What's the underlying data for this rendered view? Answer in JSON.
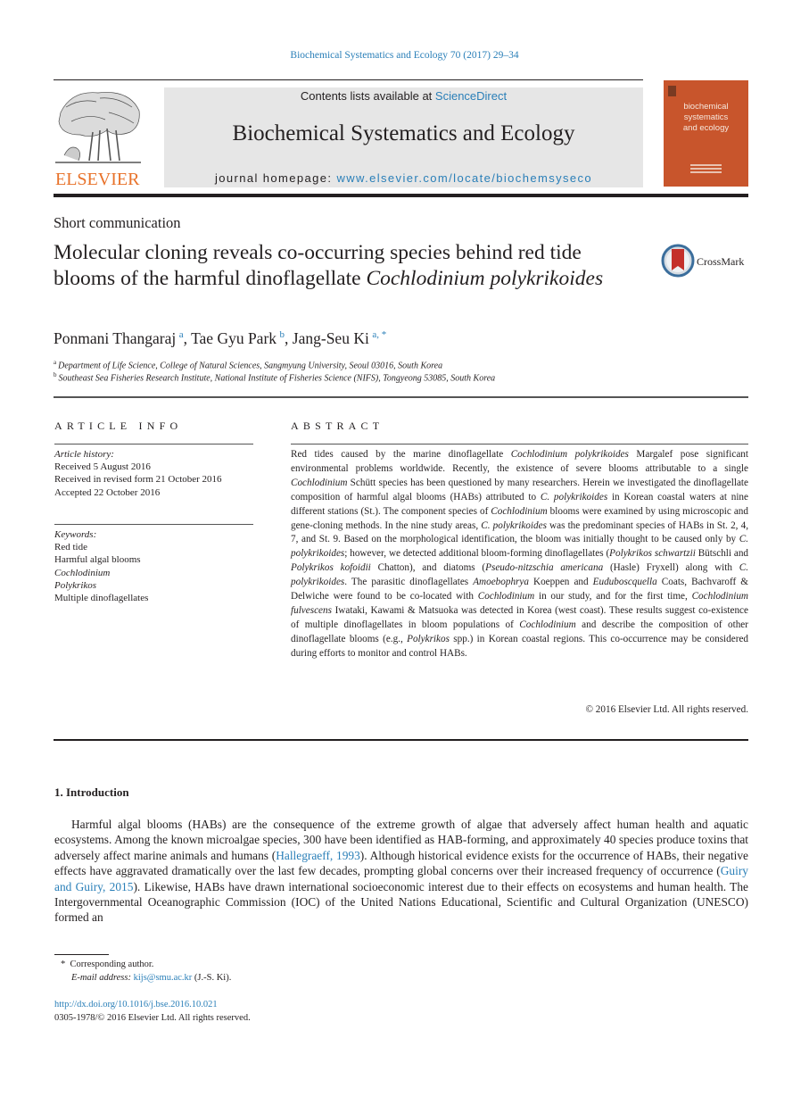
{
  "citation": "Biochemical Systematics and Ecology 70 (2017) 29–34",
  "masthead": {
    "publisher_logo_text": "ELSEVIER",
    "contents_prefix": "Contents lists available at ",
    "contents_link": "ScienceDirect",
    "journal_name": "Biochemical Systematics and Ecology",
    "homepage_prefix": "journal homepage: ",
    "homepage_link": "www.elsevier.com/locate/biochemsyseco",
    "cover_title_lines": [
      "biochemical",
      "systematics",
      "and ecology"
    ]
  },
  "article": {
    "type": "Short communication",
    "title_part1": "Molecular cloning reveals co-occurring species behind red tide blooms of the harmful dinoflagellate ",
    "title_italic": "Cochlodinium polykrikoides",
    "crossmark_label": "CrossMark",
    "authors": [
      {
        "name": "Ponmani Thangaraj",
        "sup": "a",
        "sep": ", "
      },
      {
        "name": "Tae Gyu Park",
        "sup": "b",
        "sep": ", "
      },
      {
        "name": "Jang-Seu Ki",
        "sup": "a, *",
        "sep": ""
      }
    ],
    "affiliations": [
      {
        "mark": "a",
        "text": "Department of Life Science, College of Natural Sciences, Sangmyung University, Seoul 03016, South Korea"
      },
      {
        "mark": "b",
        "text": "Southeast Sea Fisheries Research Institute, National Institute of Fisheries Science (NIFS), Tongyeong 53085, South Korea"
      }
    ]
  },
  "article_info": {
    "heading": "ARTICLE INFO",
    "history_label": "Article history:",
    "history": [
      "Received 5 August 2016",
      "Received in revised form 21 October 2016",
      "Accepted 22 October 2016"
    ],
    "keywords_label": "Keywords:",
    "keywords": [
      {
        "text": "Red tide",
        "italic": false
      },
      {
        "text": "Harmful algal blooms",
        "italic": false
      },
      {
        "text": "Cochlodinium",
        "italic": true
      },
      {
        "text": "Polykrikos",
        "italic": true
      },
      {
        "text": "Multiple dinoflagellates",
        "italic": false
      }
    ]
  },
  "abstract": {
    "heading": "ABSTRACT",
    "segments": [
      {
        "t": "Red tides caused by the marine dinoflagellate "
      },
      {
        "t": "Cochlodinium polykrikoides",
        "i": true
      },
      {
        "t": " Margalef pose significant environmental problems worldwide. Recently, the existence of severe blooms attributable to a single "
      },
      {
        "t": "Cochlodinium",
        "i": true
      },
      {
        "t": " Schütt species has been questioned by many researchers. Herein we investigated the dinoflagellate composition of harmful algal blooms (HABs) attributed to "
      },
      {
        "t": "C. polykrikoides",
        "i": true
      },
      {
        "t": " in Korean coastal waters at nine different stations (St.). The component species of "
      },
      {
        "t": "Cochlodinium",
        "i": true
      },
      {
        "t": " blooms were examined by using microscopic and gene-cloning methods. In the nine study areas, "
      },
      {
        "t": "C. polykrikoides",
        "i": true
      },
      {
        "t": " was the predominant species of HABs in St. 2, 4, 7, and St. 9. Based on the morphological identification, the bloom was initially thought to be caused only by "
      },
      {
        "t": "C. polykrikoides",
        "i": true
      },
      {
        "t": "; however, we detected additional bloom-forming dinoflagellates ("
      },
      {
        "t": "Polykrikos schwartzii",
        "i": true
      },
      {
        "t": " Bütschli and "
      },
      {
        "t": "Polykrikos kofoidii",
        "i": true
      },
      {
        "t": " Chatton), and diatoms ("
      },
      {
        "t": "Pseudo-nitzschia americana",
        "i": true
      },
      {
        "t": " (Hasle) Fryxell) along with "
      },
      {
        "t": "C. polykrikoides",
        "i": true
      },
      {
        "t": ". The parasitic dinoflagellates "
      },
      {
        "t": "Amoebophrya",
        "i": true
      },
      {
        "t": " Koeppen and "
      },
      {
        "t": "Euduboscquella",
        "i": true
      },
      {
        "t": " Coats, Bachvaroff & Delwiche were found to be co-located with "
      },
      {
        "t": "Cochlodinium",
        "i": true
      },
      {
        "t": " in our study, and for the first time, "
      },
      {
        "t": "Cochlodinium fulvescens",
        "i": true
      },
      {
        "t": " Iwataki, Kawami & Matsuoka was detected in Korea (west coast). These results suggest co-existence of multiple dinoflagellates in bloom populations of "
      },
      {
        "t": "Cochlodinium",
        "i": true
      },
      {
        "t": " and describe the composition of other dinoflagellate blooms (e.g., "
      },
      {
        "t": "Polykrikos",
        "i": true
      },
      {
        "t": " spp.) in Korean coastal regions. This co-occurrence may be considered during efforts to monitor and control HABs."
      }
    ],
    "copyright": "© 2016 Elsevier Ltd. All rights reserved."
  },
  "introduction": {
    "heading": "1.  Introduction",
    "segments": [
      {
        "t": "Harmful algal blooms (HABs) are the consequence of the extreme growth of algae that adversely affect human health and aquatic ecosystems. Among the known microalgae species, 300 have been identified as HAB-forming, and approximately 40 species produce toxins that adversely affect marine animals and humans ("
      },
      {
        "t": "Hallegraeff, 1993",
        "link": true
      },
      {
        "t": "). Although historical evidence exists for the occurrence of HABs, their negative effects have aggravated dramatically over the last few decades, prompting global concerns over their increased frequency of occurrence ("
      },
      {
        "t": "Guiry and Guiry, 2015",
        "link": true
      },
      {
        "t": "). Likewise, HABs have drawn international socioeconomic interest due to their effects on ecosystems and human health. The Intergovernmental Oceanographic Commission (IOC) of the United Nations Educational, Scientific and Cultural Organization (UNESCO) formed an"
      }
    ]
  },
  "footnotes": {
    "corresponding_mark": "*",
    "corresponding_text": "Corresponding author.",
    "email_label": "E-mail address:",
    "email": "kijs@smu.ac.kr",
    "email_suffix": " (J.-S. Ki).",
    "doi": "http://dx.doi.org/10.1016/j.bse.2016.10.021",
    "issn_line": "0305-1978/© 2016 Elsevier Ltd. All rights reserved."
  },
  "colors": {
    "link": "#2a7fb8",
    "elsevier_orange": "#e8722a",
    "cover": "#c8552c",
    "banner_gray": "#e6e6e6"
  }
}
